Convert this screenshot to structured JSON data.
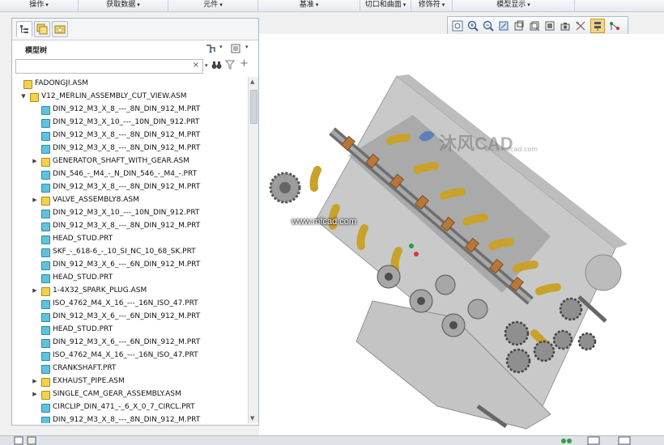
{
  "ribbon": {
    "groups": [
      {
        "label": "操作"
      },
      {
        "label": "获取数据"
      },
      {
        "label": "元件"
      },
      {
        "label": "基准"
      },
      {
        "label": "切口和曲面"
      },
      {
        "label": "修饰符"
      },
      {
        "label": "模型显示"
      }
    ]
  },
  "left_panel": {
    "title": "模型树",
    "search": {
      "value": "",
      "clear_glyph": "×"
    }
  },
  "tree": {
    "items": [
      {
        "label": "FADONGJI.ASM",
        "type": "asm",
        "indent": 0,
        "expander": ""
      },
      {
        "label": "V12_MERLIN_ASSEMBLY_CUT_VIEW.ASM",
        "type": "asm",
        "indent": 1,
        "expander": "▼"
      },
      {
        "label": "DIN_912_M3_X_8_---_8N_DIN_912_M.PRT",
        "type": "prt",
        "indent": 2,
        "expander": ""
      },
      {
        "label": "DIN_912_M3_X_10_---_10N_DIN_912.PRT",
        "type": "prt",
        "indent": 2,
        "expander": ""
      },
      {
        "label": "DIN_912_M3_X_8_---_8N_DIN_912_M.PRT",
        "type": "prt",
        "indent": 2,
        "expander": ""
      },
      {
        "label": "DIN_912_M3_X_8_---_8N_DIN_912_M.PRT",
        "type": "prt",
        "indent": 2,
        "expander": ""
      },
      {
        "label": "GENERATOR_SHAFT_WITH_GEAR.ASM",
        "type": "asm",
        "indent": 2,
        "expander": "▶"
      },
      {
        "label": "DIN_546_-_M4_-_N_DIN_546_-_M4_-.PRT",
        "type": "prt",
        "indent": 2,
        "expander": ""
      },
      {
        "label": "DIN_912_M3_X_8_---_8N_DIN_912_M.PRT",
        "type": "prt",
        "indent": 2,
        "expander": ""
      },
      {
        "label": "VALVE_ASSEMBLY8.ASM",
        "type": "asm",
        "indent": 2,
        "expander": "▶"
      },
      {
        "label": "DIN_912_M3_X_10_---_10N_DIN_912.PRT",
        "type": "prt",
        "indent": 2,
        "expander": ""
      },
      {
        "label": "DIN_912_M3_X_8_---_8N_DIN_912_M.PRT",
        "type": "prt",
        "indent": 2,
        "expander": ""
      },
      {
        "label": "HEAD_STUD.PRT",
        "type": "prt",
        "indent": 2,
        "expander": ""
      },
      {
        "label": "SKF_-_618-6_-_10_SI_NC_10_68_SK.PRT",
        "type": "prt",
        "indent": 2,
        "expander": ""
      },
      {
        "label": "DIN_912_M3_X_6_---_6N_DIN_912_M.PRT",
        "type": "prt",
        "indent": 2,
        "expander": ""
      },
      {
        "label": "HEAD_STUD.PRT",
        "type": "prt",
        "indent": 2,
        "expander": ""
      },
      {
        "label": "1-4X32_SPARK_PLUG.ASM",
        "type": "asm",
        "indent": 2,
        "expander": "▶"
      },
      {
        "label": "ISO_4762_M4_X_16_---_16N_ISO_47.PRT",
        "type": "prt",
        "indent": 2,
        "expander": ""
      },
      {
        "label": "DIN_912_M3_X_6_---_6N_DIN_912_M.PRT",
        "type": "prt",
        "indent": 2,
        "expander": ""
      },
      {
        "label": "HEAD_STUD.PRT",
        "type": "prt",
        "indent": 2,
        "expander": ""
      },
      {
        "label": "DIN_912_M3_X_6_---_6N_DIN_912_M.PRT",
        "type": "prt",
        "indent": 2,
        "expander": ""
      },
      {
        "label": "ISO_4762_M4_X_16_---_16N_ISO_47.PRT",
        "type": "prt",
        "indent": 2,
        "expander": ""
      },
      {
        "label": "CRANKSHAFT.PRT",
        "type": "prt",
        "indent": 2,
        "expander": ""
      },
      {
        "label": "EXHAUST_PIPE.ASM",
        "type": "asm",
        "indent": 2,
        "expander": "▶"
      },
      {
        "label": "SINGLE_CAM_GEAR_ASSEMBLY.ASM",
        "type": "asm",
        "indent": 2,
        "expander": "▶"
      },
      {
        "label": "CIRCLIP_DIN_471_-_6_X_0_7_CIRCL.PRT",
        "type": "prt",
        "indent": 2,
        "expander": ""
      },
      {
        "label": "DIN_912_M3_X_8_---_8N_DIN_912_M.PRT",
        "type": "prt",
        "indent": 2,
        "expander": ""
      }
    ]
  },
  "viewport": {
    "watermark_logo": "沐风CAD",
    "watermark_sub": "www.mfcad.com",
    "watermark_url": "www.mfcad.com"
  },
  "colors": {
    "asm_icon": "#f2d24c",
    "prt_icon": "#5fc3dd",
    "exhaust_gold": "#c8a22a",
    "engine_gray": "#c9c9c9"
  }
}
